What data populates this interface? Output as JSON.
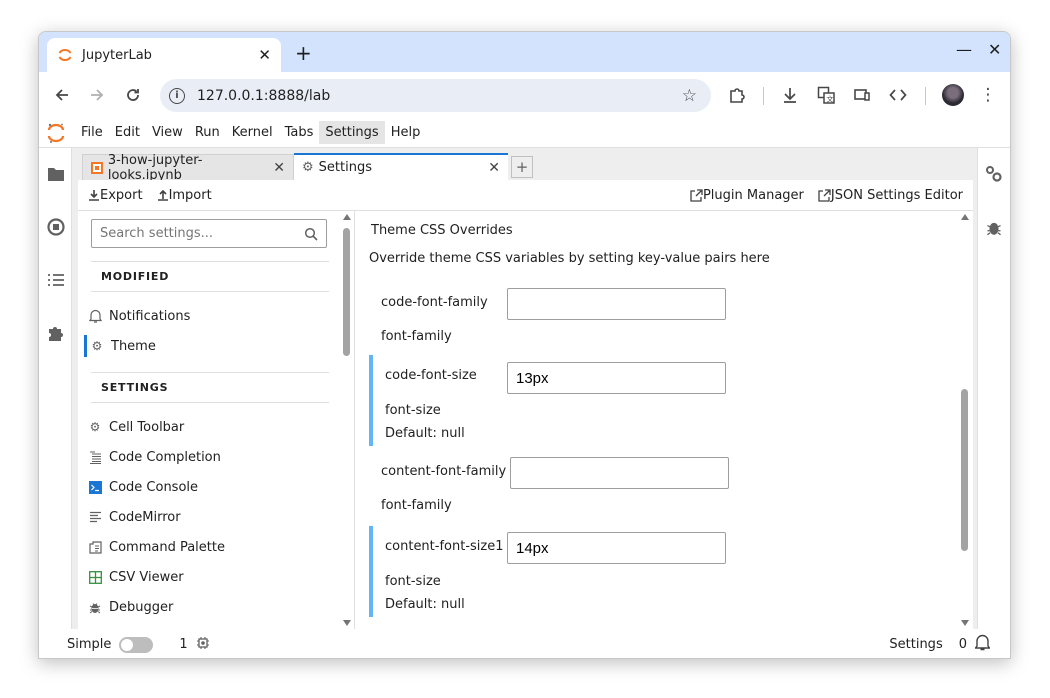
{
  "browser": {
    "tab_title": "JupyterLab",
    "url": "127.0.0.1:8888/lab"
  },
  "menubar": {
    "items": [
      "File",
      "Edit",
      "View",
      "Run",
      "Kernel",
      "Tabs",
      "Settings",
      "Help"
    ],
    "active": "Settings"
  },
  "doc_tabs": [
    {
      "label": "3-how-jupyter-looks.ipynb",
      "icon": "notebook-icon"
    },
    {
      "label": "Settings",
      "icon": "gear-icon"
    }
  ],
  "settings_toolbar": {
    "export": "Export",
    "import": "Import",
    "plugin_manager": "Plugin Manager",
    "json_editor": "JSON Settings Editor"
  },
  "sidebar": {
    "search_placeholder": "Search settings...",
    "modified_heading": "MODIFIED",
    "modified_items": [
      {
        "label": "Notifications",
        "icon": "bell-icon"
      },
      {
        "label": "Theme",
        "icon": "gear-icon",
        "selected": true
      }
    ],
    "settings_heading": "SETTINGS",
    "settings_items": [
      {
        "label": "Cell Toolbar",
        "icon": "gear-icon"
      },
      {
        "label": "Code Completion",
        "icon": "completion-icon"
      },
      {
        "label": "Code Console",
        "icon": "console-icon"
      },
      {
        "label": "CodeMirror",
        "icon": "text-lines-icon"
      },
      {
        "label": "Command Palette",
        "icon": "palette-icon"
      },
      {
        "label": "CSV Viewer",
        "icon": "grid-icon"
      },
      {
        "label": "Debugger",
        "icon": "bug-icon"
      }
    ]
  },
  "editor": {
    "title": "Theme CSS Overrides",
    "description": "Override theme CSS variables by setting key-value pairs here",
    "fields": [
      {
        "label": "code-font-family",
        "value": "",
        "type": "font-family",
        "default": "",
        "modified": false
      },
      {
        "label": "code-font-size",
        "value": "13px",
        "type": "font-size",
        "default": "Default: null",
        "modified": true
      },
      {
        "label": "content-font-family",
        "value": "",
        "type": "font-family",
        "default": "",
        "modified": false
      },
      {
        "label": "content-font-size1",
        "value": "14px",
        "type": "font-size",
        "default": "Default: null",
        "modified": true
      }
    ]
  },
  "statusbar": {
    "mode": "Simple",
    "kernels": "1",
    "right_label": "Settings",
    "notifications": "0"
  },
  "colors": {
    "accent": "#1976d2",
    "modified_bar": "#64b5f6",
    "jupyter_orange": "#f37726"
  }
}
